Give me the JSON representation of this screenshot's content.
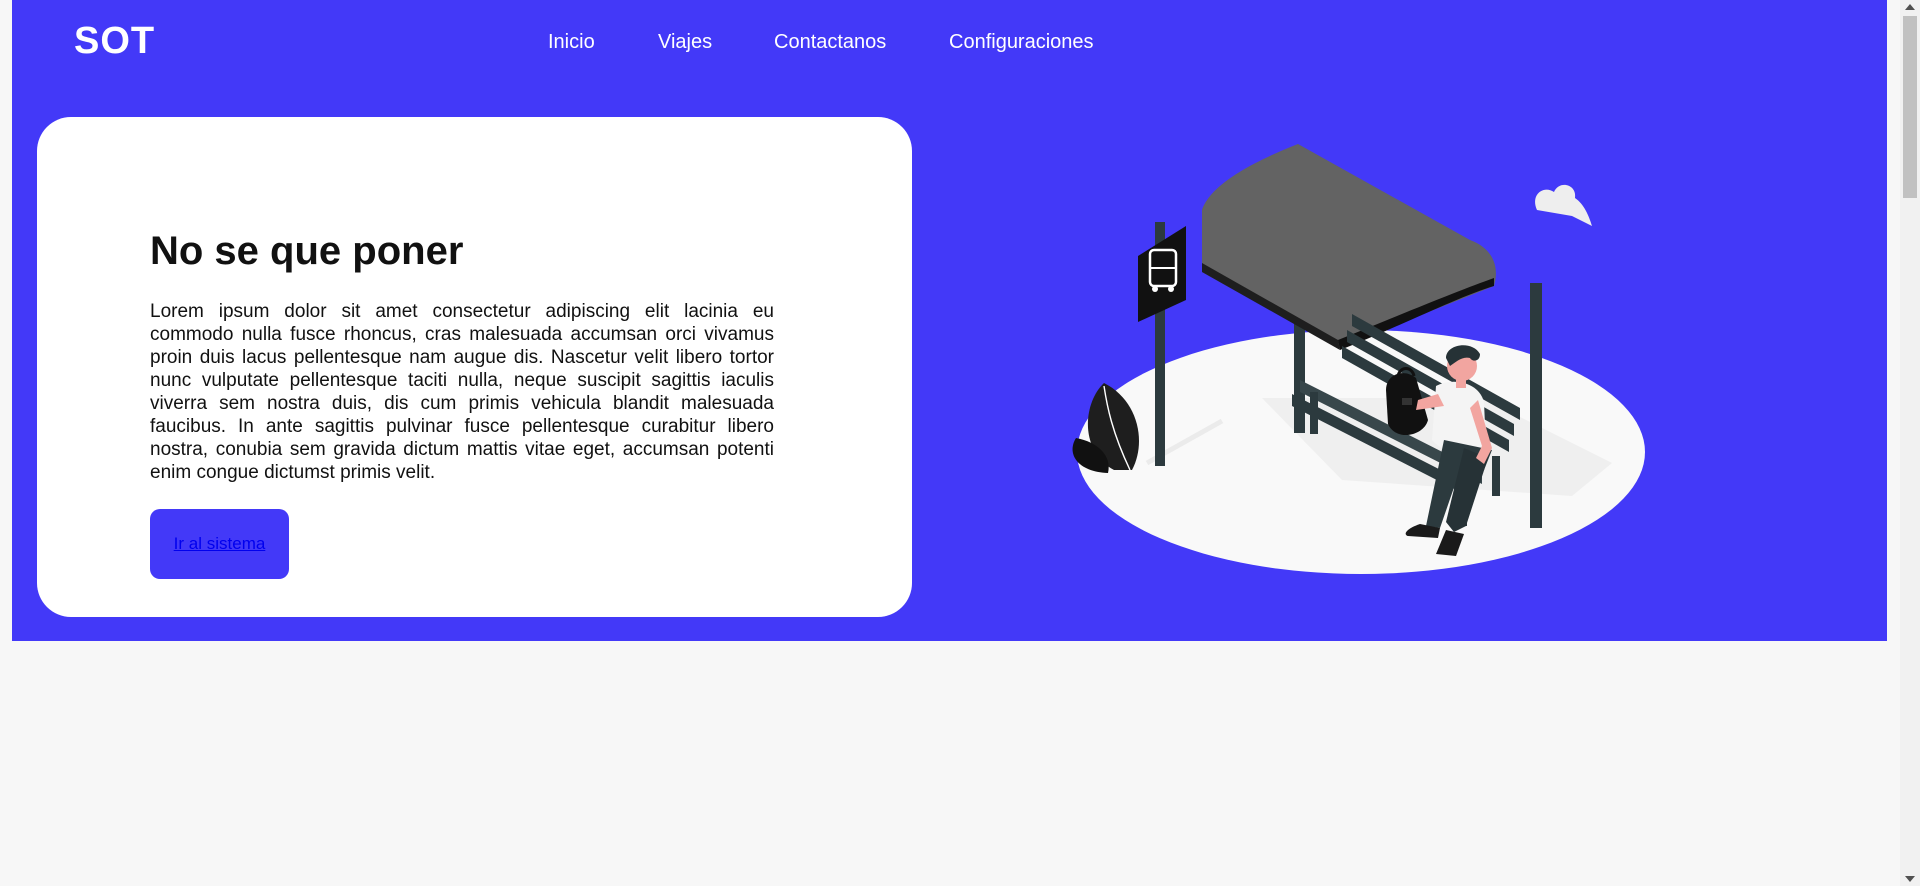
{
  "nav": {
    "logo": "SOT",
    "links": [
      "Inicio",
      "Viajes",
      "Contactanos",
      "Configuraciones"
    ]
  },
  "hero": {
    "title": "No se que poner",
    "body": "Lorem ipsum dolor sit amet consectetur adipiscing elit lacinia eu commodo nulla fusce rhoncus, cras malesuada accumsan orci vivamus proin duis lacus pellentesque nam augue dis. Nascetur velit libero tortor nunc vulputate pellentesque taciti nulla, neque suscipit sagittis iaculis viverra sem nostra duis, dis cum primis vehicula blandit malesuada faucibus. In ante sagittis pulvinar fusce pellentesque curabitur libero nostra, conubia sem gravida dictum mattis vitae eget, accumsan potenti enim congue dictumst primis velit.",
    "cta_label": "Ir al sistema"
  },
  "colors": {
    "brand": "#4339f8",
    "card": "#ffffff",
    "page_background": "#f7f7f7"
  },
  "illustration": {
    "icons": [
      "bus-stop-illustration",
      "bus-sign-icon",
      "bench-icon",
      "person-icon",
      "backpack-icon",
      "plant-icon",
      "cloud-icon"
    ]
  }
}
